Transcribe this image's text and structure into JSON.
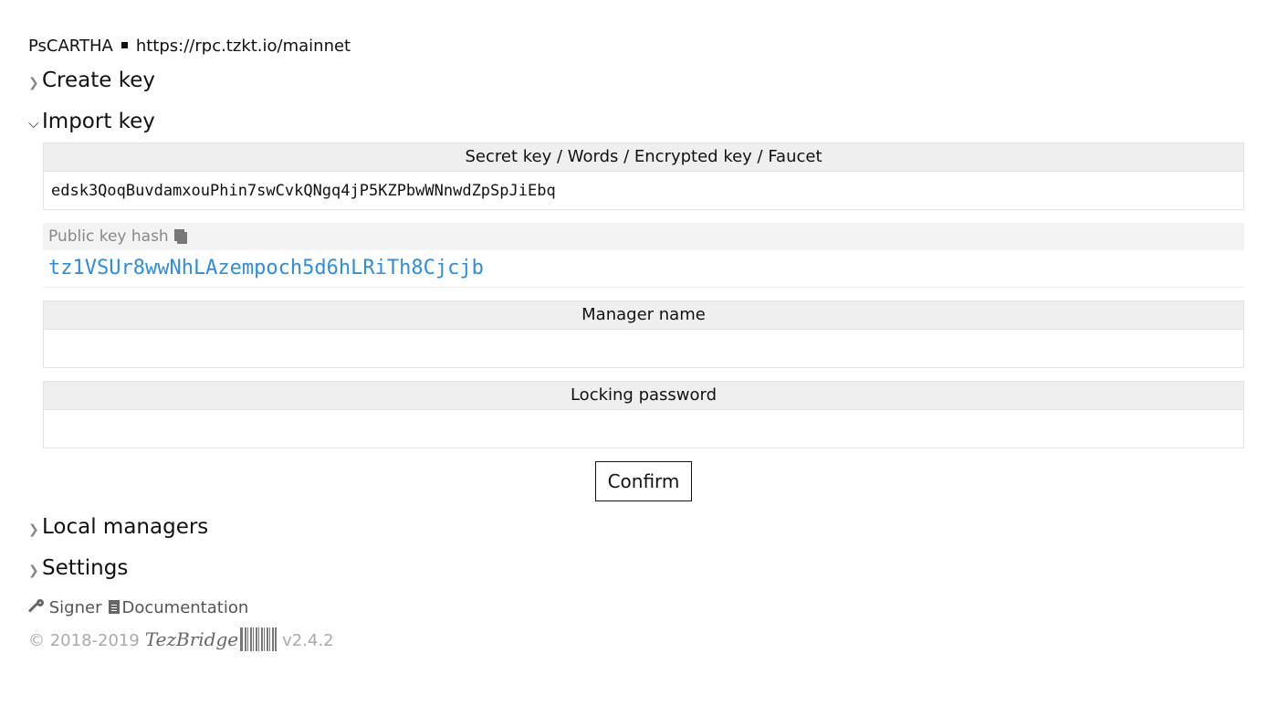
{
  "network": {
    "protocol": "PsCARTHA",
    "rpc_url": "https://rpc.tzkt.io/mainnet"
  },
  "sections": {
    "create_key": {
      "label": "Create key",
      "expanded": false
    },
    "import_key": {
      "label": "Import key",
      "expanded": true
    },
    "local_managers": {
      "label": "Local managers",
      "expanded": false
    },
    "settings": {
      "label": "Settings",
      "expanded": false
    }
  },
  "import_form": {
    "secret": {
      "label": "Secret key / Words / Encrypted key / Faucet",
      "value": "edsk3QoqBuvdamxouPhin7swCvkQNgq4jP5KZPbwWNnwdZpSpJiEbq"
    },
    "pkh": {
      "label": "Public key hash",
      "value": "tz1VSUr8wwNhLAzempoch5d6hLRiTh8Cjcjb"
    },
    "manager_name": {
      "label": "Manager name",
      "value": ""
    },
    "locking_password": {
      "label": "Locking password",
      "value": ""
    },
    "confirm_label": "Confirm"
  },
  "links": {
    "signer": "Signer",
    "documentation": "Documentation"
  },
  "footer": {
    "copyright": "© 2018-2019",
    "brand": "TezBridge",
    "version": "v2.4.2"
  },
  "colors": {
    "accent_link": "#2d8de0",
    "field_header_bg": "#efefef",
    "muted_text": "#888888"
  },
  "icons": {
    "collapsed": "chevron-right-icon",
    "expanded": "chevron-down-icon",
    "copy": "copy-icon",
    "signer": "key-icon",
    "documentation": "document-icon",
    "logo": "barcode-logo"
  }
}
